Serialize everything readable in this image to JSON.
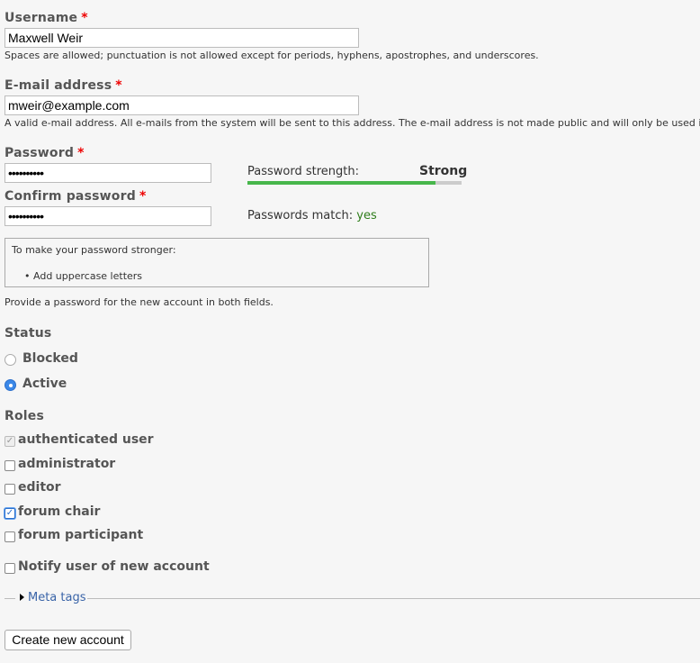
{
  "username": {
    "label": "Username",
    "required_mark": "*",
    "value": "Maxwell Weir",
    "description": "Spaces are allowed; punctuation is not allowed except for periods, hyphens, apostrophes, and underscores."
  },
  "email": {
    "label": "E-mail address",
    "required_mark": "*",
    "value": "mweir@example.com",
    "description": "A valid e-mail address. All e-mails from the system will be sent to this address. The e-mail address is not made public and will only be used if you wish to r"
  },
  "password": {
    "label": "Password",
    "required_mark": "*",
    "value": "••••••••••",
    "strength_label": "Password strength:",
    "strength_value": "Strong",
    "strength_fraction": 0.88,
    "strength_color": "#47b64b"
  },
  "confirm_password": {
    "label": "Confirm password",
    "required_mark": "*",
    "value": "••••••••••",
    "match_label": "Passwords match:",
    "match_value": "yes",
    "match_color": "#2e7d1a"
  },
  "suggestions": {
    "title": "To make your password stronger:",
    "items": [
      "Add uppercase letters"
    ]
  },
  "password_description": "Provide a password for the new account in both fields.",
  "status": {
    "label": "Status",
    "options": [
      {
        "label": "Blocked",
        "checked": false
      },
      {
        "label": "Active",
        "checked": true
      }
    ]
  },
  "roles": {
    "label": "Roles",
    "options": [
      {
        "label": "authenticated user",
        "checked": true,
        "disabled": true
      },
      {
        "label": "administrator",
        "checked": false,
        "disabled": false
      },
      {
        "label": "editor",
        "checked": false,
        "disabled": false
      },
      {
        "label": "forum chair",
        "checked": true,
        "disabled": false
      },
      {
        "label": "forum participant",
        "checked": false,
        "disabled": false
      }
    ]
  },
  "notify": {
    "label": "Notify user of new account",
    "checked": false
  },
  "meta_tags": {
    "label": "Meta tags",
    "link_color": "#3a64a8"
  },
  "submit": {
    "label": "Create new account"
  }
}
